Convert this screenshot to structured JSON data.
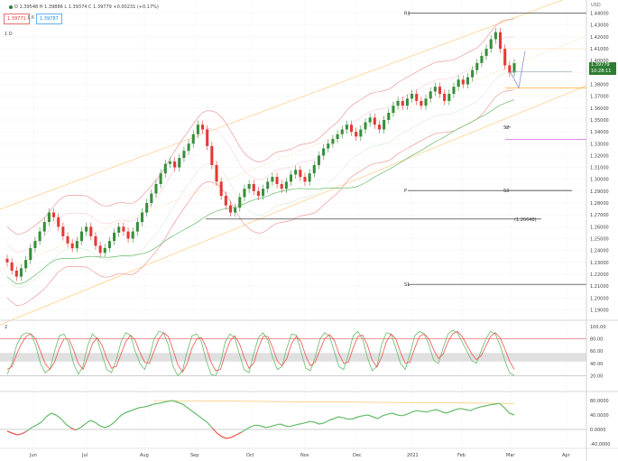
{
  "header": {
    "ohlc": "O 1.39548  H 1.39886  L 1.39374  C 1.39779  +0.00231 (+0.17%)",
    "sell_price": "1.39771",
    "spread": "1.6",
    "buy_price": "1.39787",
    "timeframe": "1 D",
    "price_tag": "1.39779",
    "price_tag_sub": "10:28:11",
    "currency": "USD",
    "sub_pane_label": "2"
  },
  "price_axis": [
    "1.44000",
    "1.43000",
    "1.42000",
    "1.41000",
    "1.40000",
    "1.39000",
    "1.38000",
    "1.37000",
    "1.36000",
    "1.35000",
    "1.34000",
    "1.33000",
    "1.32000",
    "1.31000",
    "1.30000",
    "1.29000",
    "1.28000",
    "1.27000",
    "1.26000",
    "1.25000",
    "1.24000",
    "1.23000",
    "1.22000",
    "1.21000",
    "1.20000",
    "1.19000"
  ],
  "stoch_axis": [
    "100.00",
    "80.00",
    "60.00",
    "40.00",
    "20.00"
  ],
  "osc_axis": [
    "80.0000",
    "40.0000",
    "0.0000",
    "-40.0000"
  ],
  "time_axis": [
    "Jun",
    "Jul",
    "Aug",
    "Sep",
    "Oct",
    "Nov",
    "Dec",
    "2021",
    "Feb",
    "Mar",
    "Apr"
  ],
  "pivots": [
    {
      "label": "R1",
      "price": 1.44
    },
    {
      "label": "P",
      "price": 1.2905
    },
    {
      "label": "S1",
      "price": 1.2115
    },
    {
      "label": "S2",
      "price": 1.344
    },
    {
      "label": "S3",
      "price": 1.2905
    },
    {
      "label": "(1.26648)",
      "price": 1.26648
    }
  ],
  "colors": {
    "up": "#26a69a",
    "up_body": "#388e3c",
    "down": "#e53935",
    "green_line": "#66bb6a",
    "band": "#ef9a9a",
    "channel": "#ffcc80",
    "pivot": "#222222",
    "magenta": "#e040fb",
    "orange": "#ffb74d"
  },
  "chart_data": {
    "type": "line",
    "candle_closes": [
      1.23,
      1.223,
      1.218,
      1.225,
      1.232,
      1.242,
      1.248,
      1.256,
      1.264,
      1.272,
      1.268,
      1.26,
      1.252,
      1.246,
      1.242,
      1.248,
      1.256,
      1.26,
      1.252,
      1.244,
      1.238,
      1.242,
      1.248,
      1.255,
      1.26,
      1.256,
      1.25,
      1.256,
      1.264,
      1.272,
      1.28,
      1.288,
      1.296,
      1.305,
      1.313,
      1.315,
      1.31,
      1.318,
      1.324,
      1.33,
      1.338,
      1.346,
      1.342,
      1.328,
      1.312,
      1.298,
      1.286,
      1.278,
      1.272,
      1.276,
      1.285,
      1.292,
      1.296,
      1.29,
      1.286,
      1.292,
      1.298,
      1.302,
      1.296,
      1.292,
      1.298,
      1.304,
      1.308,
      1.302,
      1.298,
      1.305,
      1.312,
      1.32,
      1.326,
      1.33,
      1.334,
      1.338,
      1.342,
      1.346,
      1.34,
      1.336,
      1.342,
      1.348,
      1.352,
      1.346,
      1.342,
      1.35,
      1.356,
      1.362,
      1.366,
      1.362,
      1.368,
      1.372,
      1.366,
      1.362,
      1.368,
      1.374,
      1.378,
      1.372,
      1.366,
      1.372,
      1.378,
      1.384,
      1.38,
      1.386,
      1.392,
      1.398,
      1.404,
      1.41,
      1.418,
      1.424,
      1.41,
      1.396,
      1.39,
      1.3978
    ],
    "stoch_k": [
      22,
      40,
      70,
      85,
      90,
      88,
      70,
      40,
      25,
      30,
      60,
      85,
      88,
      72,
      40,
      22,
      35,
      70,
      88,
      80,
      55,
      30,
      25,
      45,
      75,
      90,
      86,
      60,
      40,
      30,
      50,
      80,
      92,
      90,
      70,
      35,
      20,
      28,
      60,
      85,
      88,
      75,
      45,
      22,
      20,
      40,
      75,
      88,
      82,
      55,
      30,
      25,
      55,
      82,
      90,
      78,
      50,
      30,
      35,
      65,
      88,
      86,
      60,
      32,
      28,
      50,
      80,
      90,
      85,
      60,
      35,
      30,
      55,
      85,
      92,
      80,
      50,
      28,
      35,
      70,
      90,
      88,
      65,
      40,
      30,
      55,
      85,
      92,
      88,
      70,
      45,
      40,
      65,
      88,
      94,
      90,
      75,
      60,
      45,
      40,
      60,
      80,
      92,
      88,
      70,
      45,
      25,
      20
    ],
    "stoch_d": [
      30,
      35,
      55,
      72,
      84,
      88,
      80,
      60,
      40,
      30,
      42,
      65,
      80,
      80,
      62,
      40,
      30,
      50,
      72,
      82,
      70,
      48,
      32,
      35,
      55,
      75,
      86,
      78,
      58,
      42,
      40,
      60,
      80,
      90,
      84,
      62,
      38,
      26,
      40,
      65,
      80,
      82,
      66,
      42,
      28,
      30,
      55,
      76,
      85,
      72,
      50,
      32,
      40,
      65,
      84,
      84,
      66,
      44,
      36,
      48,
      72,
      84,
      76,
      52,
      36,
      42,
      62,
      80,
      87,
      78,
      56,
      40,
      42,
      65,
      84,
      86,
      70,
      46,
      34,
      50,
      75,
      88,
      80,
      58,
      40,
      42,
      65,
      84,
      88,
      80,
      62,
      48,
      55,
      75,
      88,
      92,
      84,
      70,
      56,
      46,
      52,
      68,
      84,
      90,
      82,
      64,
      44,
      30
    ],
    "osc_values": [
      -5,
      -10,
      -15,
      -12,
      -5,
      5,
      12,
      20,
      35,
      45,
      40,
      30,
      15,
      5,
      -2,
      5,
      15,
      25,
      20,
      10,
      5,
      10,
      20,
      35,
      45,
      50,
      55,
      60,
      62,
      65,
      70,
      72,
      75,
      78,
      80,
      75,
      70,
      60,
      50,
      40,
      30,
      20,
      5,
      -10,
      -20,
      -25,
      -22,
      -15,
      -8,
      0,
      8,
      12,
      10,
      5,
      8,
      12,
      15,
      10,
      8,
      12,
      15,
      18,
      22,
      20,
      15,
      18,
      25,
      30,
      35,
      32,
      28,
      30,
      35,
      38,
      40,
      35,
      30,
      38,
      42,
      45,
      40,
      38,
      42,
      48,
      52,
      50,
      48,
      52,
      55,
      50,
      45,
      50,
      55,
      58,
      55,
      52,
      58,
      62,
      65,
      68,
      70,
      72,
      60,
      45,
      40
    ]
  }
}
